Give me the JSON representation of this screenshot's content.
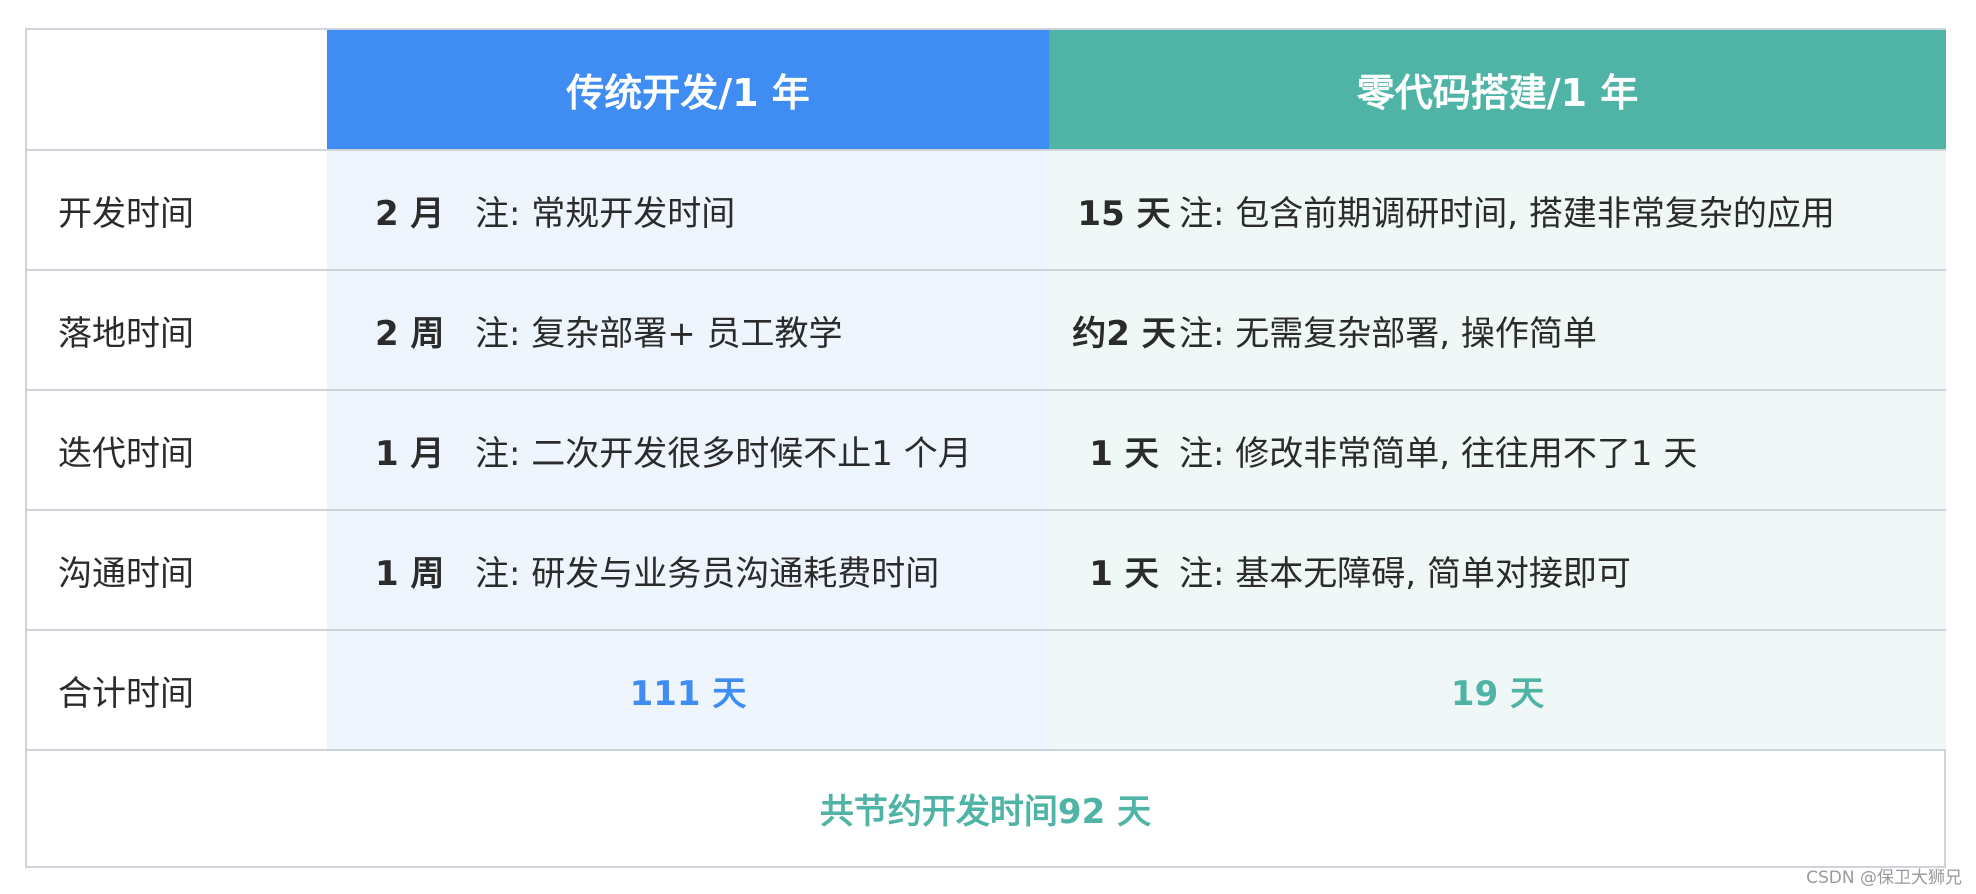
{
  "header": {
    "corner": "",
    "trad_title": "传统开发/1 年",
    "zero_title": "零代码搭建/1 年"
  },
  "rows": [
    {
      "label": "开发时间",
      "trad_value": "2 月",
      "trad_note": "注: 常规开发时间",
      "zero_value": "15 天",
      "zero_note": "注: 包含前期调研时间, 搭建非常复杂的应用"
    },
    {
      "label": "落地时间",
      "trad_value": "2 周",
      "trad_note": "注: 复杂部署+ 员工教学",
      "zero_value": "约2 天",
      "zero_note": "注: 无需复杂部署, 操作简单"
    },
    {
      "label": "迭代时间",
      "trad_value": "1 月",
      "trad_note": "注: 二次开发很多时候不止1 个月",
      "zero_value": "1 天",
      "zero_note": "注: 修改非常简单, 往往用不了1 天"
    },
    {
      "label": "沟通时间",
      "trad_value": "1 周",
      "trad_note": "注: 研发与业务员沟通耗费时间",
      "zero_value": "1 天",
      "zero_note": "注: 基本无障碍, 简单对接即可"
    }
  ],
  "total": {
    "label": "合计时间",
    "trad_value": "111 天",
    "zero_value": "19 天"
  },
  "summary": "共节约开发时间92 天",
  "watermark": "CSDN @保卫大狮兄",
  "colors": {
    "trad_accent": "#3f8cf2",
    "zero_accent": "#4fb3a6",
    "trad_bg": "#eef5fd",
    "zero_bg": "#eff8f6"
  }
}
